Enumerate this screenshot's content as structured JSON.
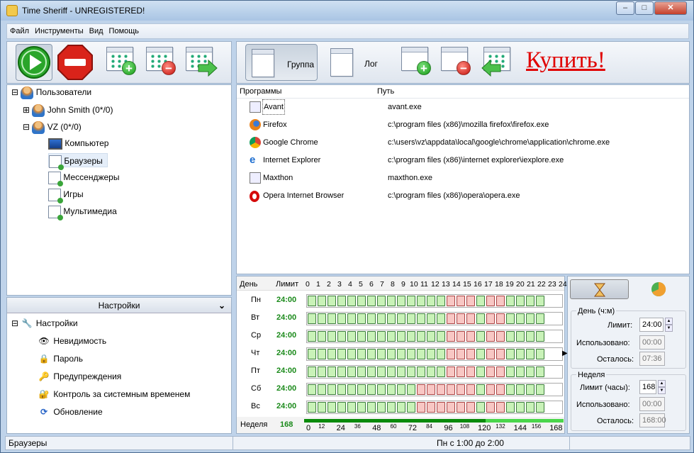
{
  "window": {
    "title": "Time Sheriff - UNREGISTERED!"
  },
  "menu": [
    "Файл",
    "Инструменты",
    "Вид",
    "Помощь"
  ],
  "right_toolbar": {
    "group_label": "Группа",
    "log_label": "Лог",
    "buy_label": "Купить!",
    "buy_color": "#e00000"
  },
  "tree": {
    "root": "Пользователи",
    "users": [
      {
        "label": "John Smith (0*/0)"
      },
      {
        "label": "VZ (0*/0)"
      }
    ],
    "groups": [
      "Компьютер",
      "Браузеры",
      "Мессенджеры",
      "Игры",
      "Мультимедиа"
    ],
    "selected": "Браузеры"
  },
  "settings": {
    "header": "Настройки",
    "root": "Настройки",
    "items": [
      "Невидимость",
      "Пароль",
      "Предупреждения",
      "Контроль за системным временем",
      "Обновление"
    ]
  },
  "programs": {
    "col_programs": "Программы",
    "col_path": "Путь",
    "rows": [
      {
        "name": "Avant",
        "path": "avant.exe"
      },
      {
        "name": "Firefox",
        "path": "c:\\program files (x86)\\mozilla firefox\\firefox.exe"
      },
      {
        "name": "Google Chrome",
        "path": "c:\\users\\vz\\appdata\\local\\google\\chrome\\application\\chrome.exe"
      },
      {
        "name": "Internet Explorer",
        "path": "c:\\program files (x86)\\internet explorer\\iexplore.exe"
      },
      {
        "name": "Maxthon",
        "path": "maxthon.exe"
      },
      {
        "name": "Opera Internet Browser",
        "path": "c:\\program files (x86)\\opera\\opera.exe"
      }
    ]
  },
  "schedule": {
    "col_day": "День",
    "col_limit": "Лимит",
    "hours": [
      "0",
      "1",
      "2",
      "3",
      "4",
      "5",
      "6",
      "7",
      "8",
      "9",
      "10",
      "11",
      "12",
      "13",
      "14",
      "15",
      "16",
      "17",
      "18",
      "19",
      "20",
      "21",
      "22",
      "23",
      "24"
    ],
    "days": [
      {
        "name": "Пн",
        "limit": "24:00",
        "blocked": [
          14,
          15,
          16,
          18,
          19
        ]
      },
      {
        "name": "Вт",
        "limit": "24:00",
        "blocked": [
          14,
          15,
          16,
          18,
          19
        ]
      },
      {
        "name": "Ср",
        "limit": "24:00",
        "blocked": [
          14,
          15,
          16,
          18,
          19
        ]
      },
      {
        "name": "Чт",
        "limit": "24:00",
        "blocked": [
          14,
          15,
          16,
          18,
          19
        ]
      },
      {
        "name": "Пт",
        "limit": "24:00",
        "blocked": [
          14,
          15,
          16,
          18,
          19
        ]
      },
      {
        "name": "Сб",
        "limit": "24:00",
        "blocked": [
          11,
          12,
          13,
          14,
          15,
          16,
          18,
          19
        ]
      },
      {
        "name": "Вс",
        "limit": "24:00",
        "blocked": [
          11,
          12,
          13,
          14,
          15,
          16,
          18,
          19
        ]
      }
    ],
    "week_label": "Неделя",
    "week_limit": "168",
    "week_ticks": [
      "0",
      "12",
      "24",
      "36",
      "48",
      "60",
      "72",
      "84",
      "96",
      "108",
      "120",
      "132",
      "144",
      "156",
      "168"
    ]
  },
  "limits": {
    "day_title": "День (ч:м)",
    "limit_label": "Лимит:",
    "limit_value": "24:00",
    "used_label": "Использовано:",
    "used_value": "00:00",
    "left_label": "Осталось:",
    "left_value": "07:36",
    "week_title": "Неделя",
    "wlimit_label": "Лимит (часы):",
    "wlimit_value": "168",
    "wused_label": "Использовано:",
    "wused_value": "00:00",
    "wleft_label": "Осталось:",
    "wleft_value": "168:00"
  },
  "status": {
    "left": "Браузеры",
    "center": "Пн с 1:00 до 2:00"
  }
}
